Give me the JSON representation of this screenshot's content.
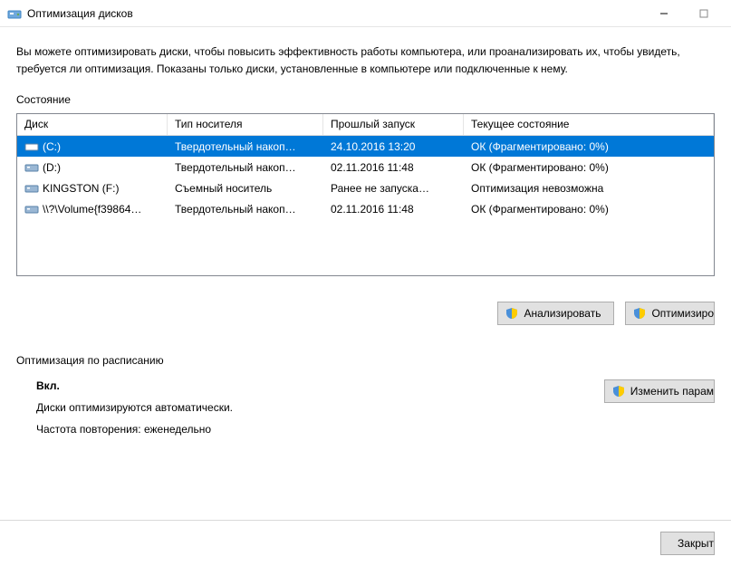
{
  "window": {
    "title": "Оптимизация дисков"
  },
  "intro": "Вы можете оптимизировать диски, чтобы повысить эффективность работы компьютера, или проанализировать их, чтобы увидеть, требуется ли оптимизация. Показаны только диски, установленные в компьютере или подключенные к нему.",
  "state_caption": "Состояние",
  "columns": {
    "disk": "Диск",
    "type": "Тип носителя",
    "last": "Прошлый запуск",
    "status": "Текущее состояние"
  },
  "rows": [
    {
      "disk": "(C:)",
      "type": "Твердотельный накоп…",
      "last": "24.10.2016 13:20",
      "status": "ОК (Фрагментировано: 0%)",
      "selected": true
    },
    {
      "disk": "(D:)",
      "type": "Твердотельный накоп…",
      "last": "02.11.2016 11:48",
      "status": "ОК (Фрагментировано: 0%)",
      "selected": false
    },
    {
      "disk": "KINGSTON (F:)",
      "type": "Съемный носитель",
      "last": "Ранее не запуска…",
      "status": "Оптимизация невозможна",
      "selected": false
    },
    {
      "disk": "\\\\?\\Volume{f39864…",
      "type": "Твердотельный накоп…",
      "last": "02.11.2016 11:48",
      "status": "ОК (Фрагментировано: 0%)",
      "selected": false
    }
  ],
  "buttons": {
    "analyze": "Анализировать",
    "optimize": "Оптимизиро",
    "change": "Изменить парам",
    "close": "Закрыт"
  },
  "schedule": {
    "caption": "Оптимизация по расписанию",
    "on": "Вкл.",
    "auto": "Диски оптимизируются автоматически.",
    "freq": "Частота повторения: еженедельно"
  }
}
